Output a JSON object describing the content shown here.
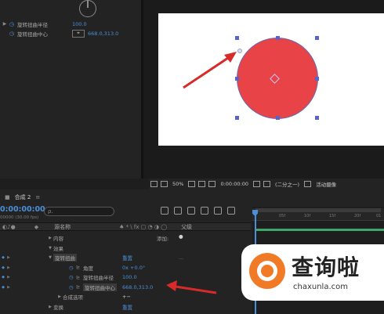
{
  "effect_controls": {
    "rows": [
      {
        "name": "旋转扭曲半径",
        "value": "100.0"
      },
      {
        "name": "旋转扭曲中心",
        "value": "668.0,313.0"
      }
    ]
  },
  "viewer_toolbar": {
    "zoom": "50%",
    "timecode": "0:00:00:00",
    "resolution": "(二分之一)",
    "active_camera": "活动摄像"
  },
  "timeline": {
    "tab": "合成 2",
    "timecode": "0:00:00:00",
    "fps": "00000 (30.00 fps)",
    "search_placeholder": "ρ.",
    "header": {
      "source_name": "源名称",
      "parent": "父级"
    },
    "rows": [
      {
        "name": "内容",
        "value": "添加:"
      },
      {
        "name": "效果",
        "value": ""
      },
      {
        "name": "旋转扭曲",
        "value": "重置",
        "extra": "..."
      },
      {
        "name": "角度",
        "value": "0x +0.0°"
      },
      {
        "name": "旋转扭曲半径",
        "value": "100.0"
      },
      {
        "name": "旋转扭曲中心",
        "value": "668.0,313.0"
      },
      {
        "name": "合成选项",
        "value": "+−"
      },
      {
        "name": "变换",
        "value": "重置"
      }
    ],
    "ruler_ticks": [
      "05f",
      "10f",
      "15f",
      "20f",
      "01"
    ]
  },
  "watermark": {
    "title": "查询啦",
    "url": "chaxunla.com"
  },
  "colors": {
    "accent_blue": "#4a8fd8",
    "circle_red": "#e84347",
    "arrow_red": "#d92a2a",
    "logo_orange": "#f07a26"
  }
}
